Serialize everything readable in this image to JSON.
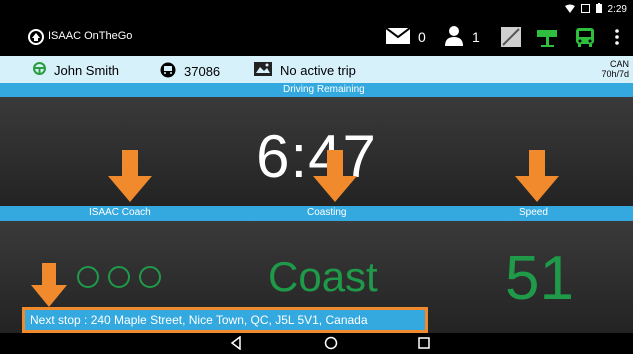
{
  "status_bar": {
    "time": "2:29",
    "icons": [
      "wifi-icon",
      "signal-icon",
      "battery-icon"
    ]
  },
  "app_bar": {
    "title": "ISAAC OnTheGo",
    "messages_count": "0",
    "users_count": "1",
    "icons": [
      "mail-icon",
      "person-icon",
      "no-signal-icon",
      "road-sign-icon",
      "bus-icon",
      "overflow-menu-icon"
    ],
    "colors": {
      "bus": "#2fbf3f",
      "sign": "#2fbf3f"
    }
  },
  "info_bar": {
    "driver_name": "John Smith",
    "vehicle_id": "37086",
    "trip_status": "No active trip",
    "region": "CAN",
    "cycle": "70h/7d"
  },
  "driving_remaining": {
    "label": "Driving Remaining",
    "value": "6:47"
  },
  "section_labels": {
    "coach": "ISAAC Coach",
    "coasting": "Coasting",
    "speed": "Speed"
  },
  "metrics": {
    "coach_indicators": 3,
    "coasting_value": "Coast",
    "speed_value": "51"
  },
  "next_stop": "Next stop : 240 Maple Street, Nice Town, QC, J5L 5V1, Canada",
  "nav": [
    "back-icon",
    "home-icon",
    "recents-icon"
  ],
  "colors": {
    "accent_blue": "#33a9e0",
    "info_bg": "#d7f1fb",
    "green": "#1f9a49",
    "arrow_orange": "#f08a2d"
  }
}
